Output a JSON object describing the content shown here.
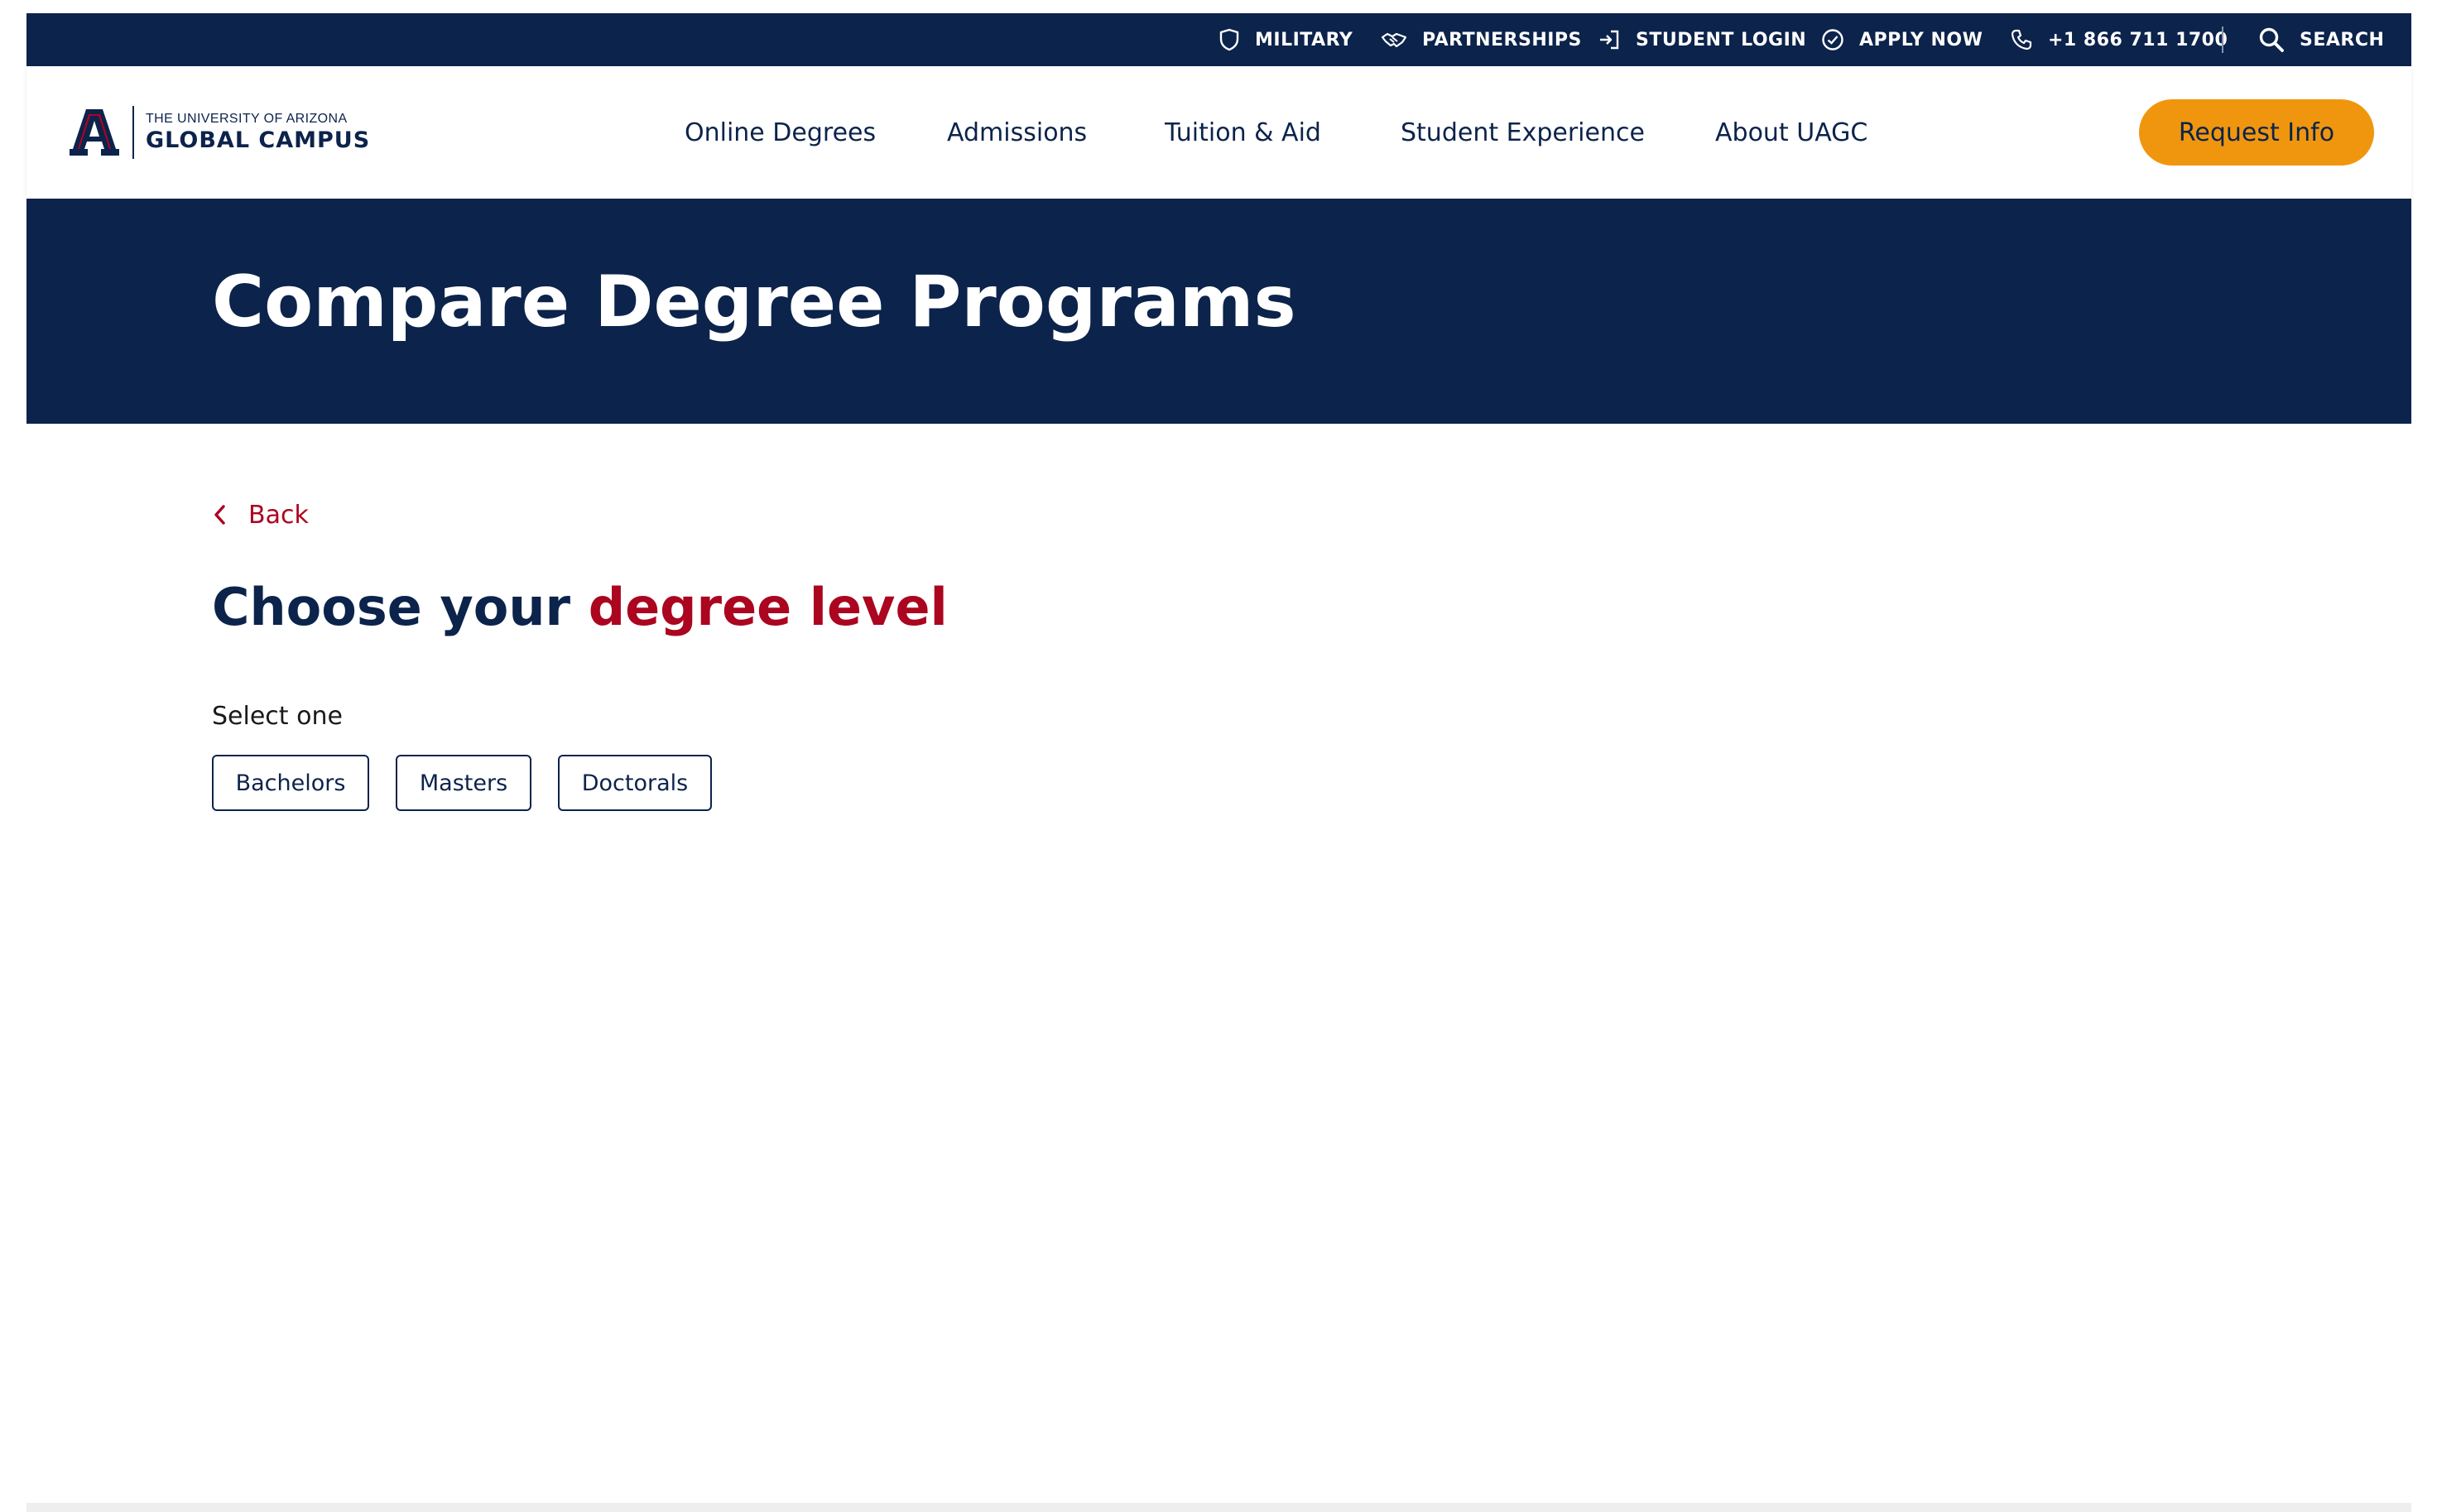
{
  "utility_nav": {
    "items": [
      {
        "label": "MILITARY",
        "icon": "shield-icon"
      },
      {
        "label": "PARTNERSHIPS",
        "icon": "handshake-icon"
      },
      {
        "label": "STUDENT LOGIN",
        "icon": "login-icon"
      },
      {
        "label": "APPLY NOW",
        "icon": "check-circle-icon"
      },
      {
        "label": "+1 866 711 1700",
        "icon": "phone-icon"
      },
      {
        "label": "SEARCH",
        "icon": "search-icon"
      }
    ]
  },
  "logo": {
    "small_text": "THE UNIVERSITY OF ARIZONA",
    "big_text": "GLOBAL CAMPUS",
    "icon": "arizona-a-icon"
  },
  "main_nav": {
    "items": [
      {
        "label": "Online Degrees"
      },
      {
        "label": "Admissions"
      },
      {
        "label": "Tuition & Aid"
      },
      {
        "label": "Student Experience"
      },
      {
        "label": "About UAGC"
      }
    ],
    "cta_label": "Request Info"
  },
  "hero": {
    "title": "Compare Degree Programs"
  },
  "content": {
    "back_label": "Back",
    "heading_part1": "Choose your ",
    "heading_part2": "degree level",
    "select_label": "Select one",
    "options": [
      {
        "label": "Bachelors"
      },
      {
        "label": "Masters"
      },
      {
        "label": "Doctorals"
      }
    ]
  },
  "colors": {
    "navy": "#0c234b",
    "red": "#ab0520",
    "orange": "#f0960e"
  }
}
